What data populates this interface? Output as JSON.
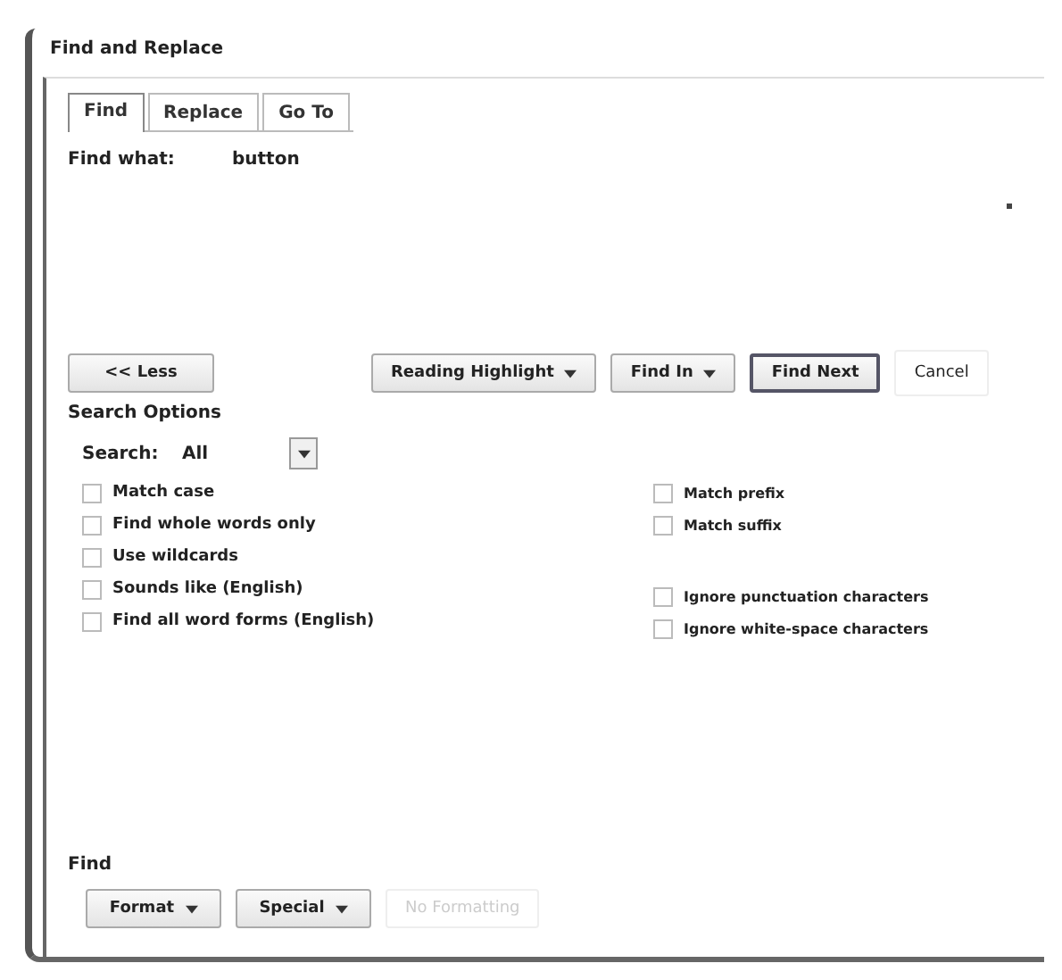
{
  "window": {
    "title": "Find and Replace"
  },
  "tabs": [
    {
      "label": "Find",
      "selected": true
    },
    {
      "label": "Replace",
      "selected": false
    },
    {
      "label": "Go To",
      "selected": false
    }
  ],
  "find_what": {
    "label": "Find what:",
    "value": "button"
  },
  "buttons": [
    {
      "label": "<< Less",
      "kind": "plain"
    },
    {
      "label": "Reading Highlight",
      "kind": "menu"
    },
    {
      "label": "Find In",
      "kind": "menu"
    },
    {
      "label": "Find Next",
      "kind": "default"
    },
    {
      "label": "Cancel",
      "kind": "flat"
    }
  ],
  "search_options": {
    "title": "Search Options",
    "search_label": "Search:",
    "search_value": "All"
  },
  "options_left": [
    {
      "label": "Match case",
      "checked": false
    },
    {
      "label": "Find whole words only",
      "checked": false
    },
    {
      "label": "Use wildcards",
      "checked": false
    },
    {
      "label": "Sounds like (English)",
      "checked": false
    },
    {
      "label": "Find all word forms (English)",
      "checked": false
    }
  ],
  "options_right": [
    {
      "label": "Match prefix",
      "checked": false
    },
    {
      "label": "Match suffix",
      "checked": false
    },
    {
      "label": "Ignore punctuation characters",
      "checked": false
    },
    {
      "label": "Ignore white-space characters",
      "checked": false
    }
  ],
  "find_section": {
    "title": "Find",
    "buttons": [
      {
        "label": "Format",
        "disabled": false
      },
      {
        "label": "Special",
        "disabled": false
      },
      {
        "label": "No Formatting",
        "disabled": true
      }
    ]
  }
}
